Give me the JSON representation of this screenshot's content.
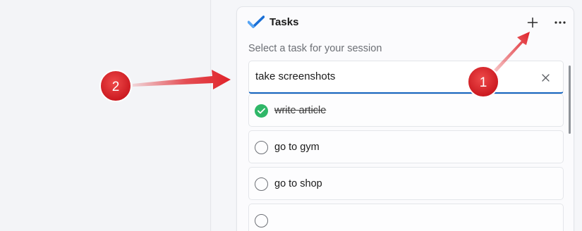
{
  "header": {
    "title": "Tasks",
    "app_icon": "checkmark-icon",
    "add_icon": "plus-icon",
    "more_icon": "more-horizontal-icon"
  },
  "prompt": "Select a task for your session",
  "input": {
    "value": "take screenshots",
    "clear_icon": "close-icon"
  },
  "tasks": [
    {
      "label": "write article",
      "completed": true
    },
    {
      "label": "go to gym",
      "completed": false
    },
    {
      "label": "go to shop",
      "completed": false
    }
  ],
  "annotations": [
    {
      "number": "1",
      "target": "add-task-button"
    },
    {
      "number": "2",
      "target": "task-input"
    }
  ],
  "colors": {
    "accent": "#1565c0",
    "check_done": "#2fb768",
    "annotation_red": "#e0232a"
  }
}
